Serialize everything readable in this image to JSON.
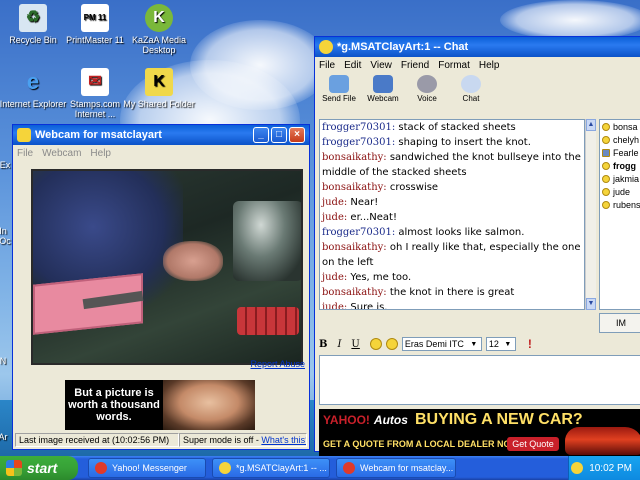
{
  "desktop": {
    "icons": [
      {
        "label": "Recycle Bin",
        "icon": "recycle-bin-icon"
      },
      {
        "label": "PrintMaster 11",
        "icon": "printmaster-icon",
        "badge": "PM 11"
      },
      {
        "label": "KaZaA Media Desktop",
        "icon": "kazaa-icon"
      },
      {
        "label": "Internet Explorer",
        "icon": "internet-explorer-icon"
      },
      {
        "label": "Stamps.com Internet ...",
        "icon": "stamps-icon"
      },
      {
        "label": "My Shared Folder",
        "icon": "shared-folder-icon"
      }
    ],
    "partial_labels": [
      "Ex",
      "In",
      "Oc",
      "N",
      "Ar"
    ]
  },
  "webcam_window": {
    "title": "Webcam for msatclayart",
    "menu": [
      "File",
      "Webcam",
      "Help"
    ],
    "report_abuse": "Report Abuse",
    "ad_text": "But a picture is worth a thousand words.",
    "status_last_image": "Last image received at (10:02:56 PM)",
    "status_super_mode": "Super mode is off - ",
    "whats_this": "What's this?"
  },
  "chat_window": {
    "title": "*g.MSATClayArt:1 -- Chat",
    "menu": [
      "File",
      "Edit",
      "View",
      "Friend",
      "Format",
      "Help"
    ],
    "toolbar": [
      {
        "label": "Send File",
        "icon": "send-file-icon"
      },
      {
        "label": "Webcam",
        "icon": "webcam-icon"
      },
      {
        "label": "Voice",
        "icon": "microphone-icon"
      },
      {
        "label": "Chat",
        "icon": "chat-bubbles-icon"
      }
    ],
    "messages": [
      {
        "nick": "frogger70301:",
        "text": " stack of stacked sheets",
        "kind": "f"
      },
      {
        "nick": "frogger70301:",
        "text": " shaping to insert the knot.",
        "kind": "f"
      },
      {
        "nick": "bonsaikathy:",
        "text": " sandwiched the knot bullseye into the middle of the stacked sheets",
        "kind": "b"
      },
      {
        "nick": "bonsaikathy:",
        "text": " crosswise",
        "kind": "b"
      },
      {
        "nick": "jude:",
        "text": " Near!",
        "kind": "b"
      },
      {
        "nick": "jude:",
        "text": " er...Neat!",
        "kind": "b"
      },
      {
        "nick": "frogger70301:",
        "text": " almost looks like salmon.",
        "kind": "f"
      },
      {
        "nick": "bonsaikathy:",
        "text": " oh I really like that, especially the one on the left",
        "kind": "b"
      },
      {
        "nick": "jude:",
        "text": " Yes, me too.",
        "kind": "b"
      },
      {
        "nick": "bonsaikathy:",
        "text": " the knot in there is great",
        "kind": "b"
      },
      {
        "nick": "jude:",
        "text": " Sure is.",
        "kind": "b"
      }
    ],
    "users": [
      {
        "name": "bonsa",
        "bold": false,
        "icon": "smiley"
      },
      {
        "name": "chelyh",
        "bold": false,
        "icon": "smiley"
      },
      {
        "name": "Fearle",
        "bold": false,
        "icon": "square"
      },
      {
        "name": "frogg",
        "bold": true,
        "icon": "smiley"
      },
      {
        "name": "jakmia",
        "bold": false,
        "icon": "smiley"
      },
      {
        "name": "jude",
        "bold": false,
        "icon": "smiley"
      },
      {
        "name": "rubens",
        "bold": false,
        "icon": "smiley"
      }
    ],
    "im_button": "IM",
    "format": {
      "bold": "B",
      "italic": "I",
      "underline": "U",
      "font": "Eras Demi ITC",
      "size": "12"
    },
    "ad": {
      "brand": "YAHOO!",
      "brand_sub": "Autos",
      "headline": "BUYING A NEW CAR?",
      "subline": "GET A QUOTE FROM A LOCAL DEALER NOW.",
      "cta": "Get Quote"
    }
  },
  "taskbar": {
    "start": "start",
    "tasks": [
      {
        "label": "Yahoo! Messenger",
        "icon": "yahoo-messenger-icon",
        "color": "#e03a2a"
      },
      {
        "label": "*g.MSATClayArt:1 -- ...",
        "icon": "yahoo-chat-icon",
        "color": "#f5d43a"
      },
      {
        "label": "Webcam for msatclay...",
        "icon": "webcam-task-icon",
        "color": "#e03a2a"
      }
    ],
    "clock": "10:02 PM"
  }
}
